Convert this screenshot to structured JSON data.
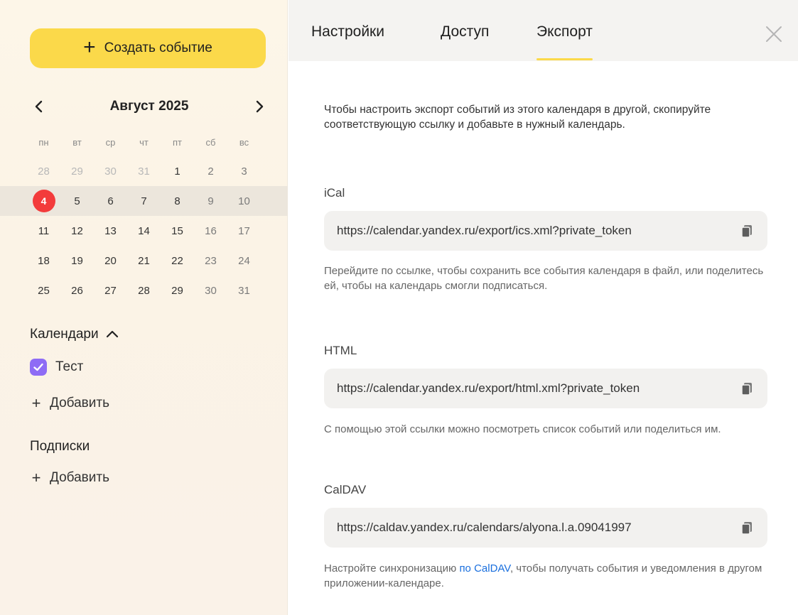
{
  "sidebar": {
    "create_button": {
      "plus": "+",
      "label": "Создать событие"
    },
    "calendar": {
      "month_title": "Август 2025",
      "weekdays": [
        "пн",
        "вт",
        "ср",
        "чт",
        "пт",
        "сб",
        "вс"
      ],
      "weeks": [
        [
          "28",
          "29",
          "30",
          "31",
          "1",
          "2",
          "3"
        ],
        [
          "4",
          "5",
          "6",
          "7",
          "8",
          "9",
          "10"
        ],
        [
          "11",
          "12",
          "13",
          "14",
          "15",
          "16",
          "17"
        ],
        [
          "18",
          "19",
          "20",
          "21",
          "22",
          "23",
          "24"
        ],
        [
          "25",
          "26",
          "27",
          "28",
          "29",
          "30",
          "31"
        ]
      ],
      "today": "4"
    },
    "calendars_section": {
      "title": "Календари"
    },
    "calendar_items": [
      {
        "label": "Тест",
        "color": "#8e6cf5"
      }
    ],
    "calendars_add": {
      "plus": "+",
      "label": "Добавить"
    },
    "subscriptions_section": {
      "title": "Подписки"
    },
    "subscriptions_add": {
      "plus": "+",
      "label": "Добавить"
    }
  },
  "panel": {
    "tabs": [
      {
        "label": "Настройки"
      },
      {
        "label": "Доступ"
      },
      {
        "label": "Экспорт",
        "active": true
      }
    ],
    "intro": "Чтобы настроить экспорт событий из этого календаря в другой, скопируйте соответствующую ссылку и добавьте в нужный календарь.",
    "ical": {
      "label": "iCal",
      "url": "https://calendar.yandex.ru/export/ics.xml?private_token",
      "hint": "Перейдите по ссылке, чтобы сохранить все события календаря в файл, или поделитесь ей, чтобы на календарь смогли подписаться."
    },
    "html": {
      "label": "HTML",
      "url": "https://calendar.yandex.ru/export/html.xml?private_token",
      "hint": "С помощью этой ссылки можно посмотреть список событий или поделиться им."
    },
    "caldav": {
      "label": "CalDAV",
      "url": "https://caldav.yandex.ru/calendars/alyona.l.a.09041997",
      "hint_before": "Настройте синхронизацию ",
      "hint_link": "по CalDAV",
      "hint_after": ", чтобы получать события и уведомления в другом приложении-календаре."
    }
  },
  "colors": {
    "accent": "#fbd94a",
    "today": "#f33b3b",
    "link": "#1a6fde"
  }
}
